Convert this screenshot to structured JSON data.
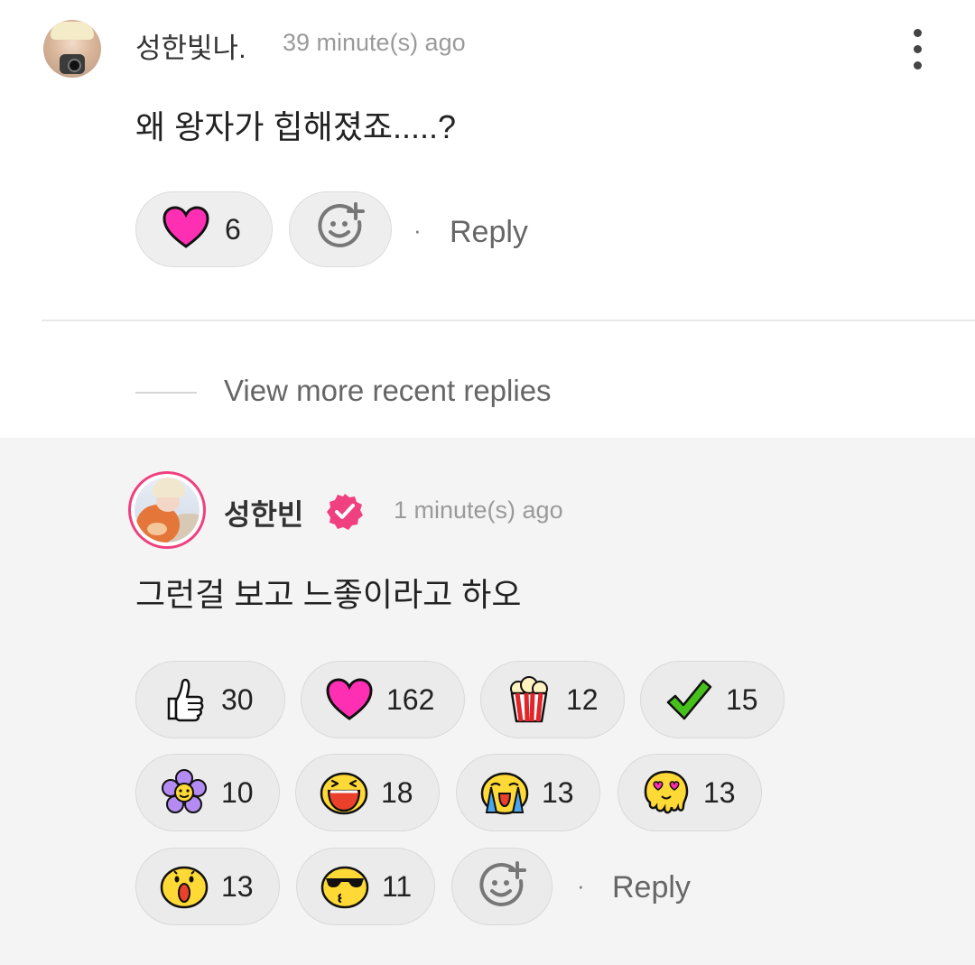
{
  "comment": {
    "author": "성한빛나.",
    "time": "39 minute(s) ago",
    "text": "왜 왕자가 힙해졌죠.....?",
    "likes": "6",
    "reply_label": "Reply",
    "separator": "·"
  },
  "view_more": "View more recent replies",
  "reply": {
    "author": "성한빈",
    "time": "1 minute(s) ago",
    "text": "그런걸 보고 느좋이라고 하오",
    "reply_label": "Reply",
    "separator": "·",
    "reactions": [
      {
        "icon": "thumbs-up-icon",
        "count": "30"
      },
      {
        "icon": "heart-icon",
        "count": "162"
      },
      {
        "icon": "popcorn-icon",
        "count": "12"
      },
      {
        "icon": "checkmark-icon",
        "count": "15"
      },
      {
        "icon": "flower-icon",
        "count": "10"
      },
      {
        "icon": "laughing-face-icon",
        "count": "18"
      },
      {
        "icon": "crying-face-icon",
        "count": "13"
      },
      {
        "icon": "heart-eyes-melting-icon",
        "count": "13"
      },
      {
        "icon": "surprised-face-icon",
        "count": "13"
      },
      {
        "icon": "sunglasses-kiss-icon",
        "count": "11"
      }
    ]
  },
  "colors": {
    "heart": "#ff2fb4",
    "verified": "#f0407f",
    "reply_bg": "#f4f4f4"
  }
}
